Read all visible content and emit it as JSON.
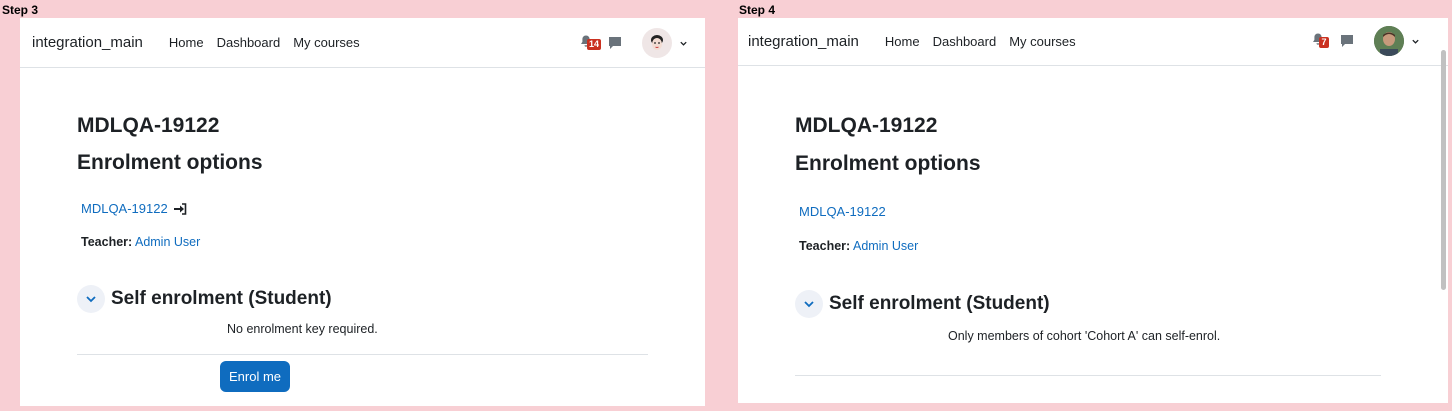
{
  "steps": [
    {
      "step_label": "Step 3",
      "site_name": "integration_main",
      "nav_links": [
        "Home",
        "Dashboard",
        "My courses"
      ],
      "notification_count": "14",
      "course_title": "MDLQA-19122",
      "page_heading": "Enrolment options",
      "course_link_text": "MDLQA-19122",
      "teacher_label": "Teacher:",
      "teacher_name": "Admin User",
      "section_title": "Self enrolment (Student)",
      "enrol_info": "No enrolment key required.",
      "enrol_button": "Enrol me"
    },
    {
      "step_label": "Step 4",
      "site_name": "integration_main",
      "nav_links": [
        "Home",
        "Dashboard",
        "My courses"
      ],
      "notification_count": "7",
      "course_title": "MDLQA-19122",
      "page_heading": "Enrolment options",
      "course_link_text": "MDLQA-19122",
      "teacher_label": "Teacher:",
      "teacher_name": "Admin User",
      "section_title": "Self enrolment (Student)",
      "enrol_info": "Only members of cohort 'Cohort A' can self-enrol."
    }
  ],
  "colors": {
    "background": "#f8cfd4",
    "link": "#0f6cbf",
    "badge": "#ca3120",
    "primary_button": "#0f6cbf"
  }
}
